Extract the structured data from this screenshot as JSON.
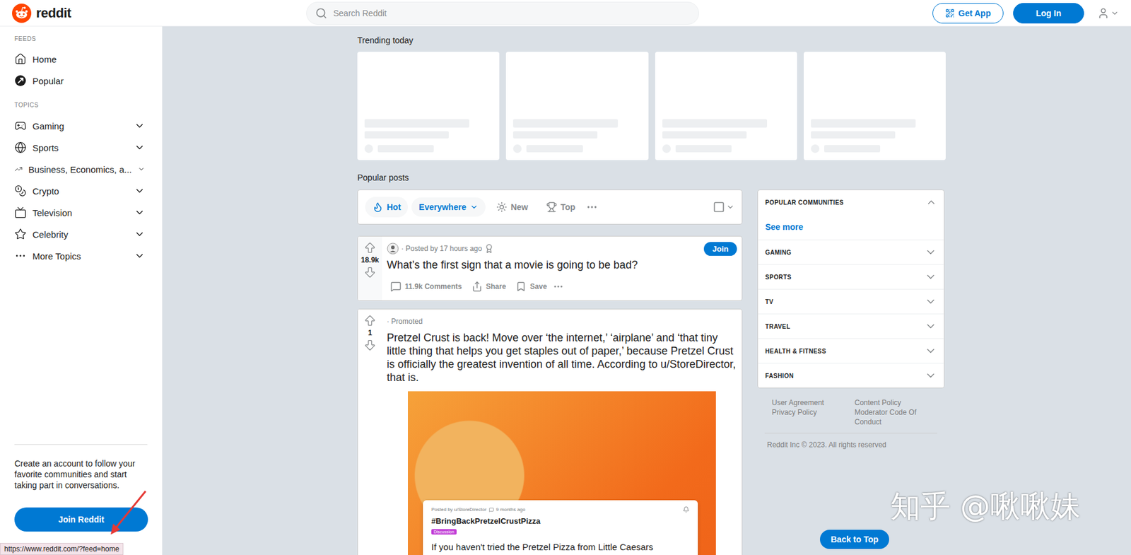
{
  "header": {
    "logo": "reddit",
    "search_placeholder": "Search Reddit",
    "get_app": "Get App",
    "log_in": "Log In"
  },
  "sidebar": {
    "sections": [
      {
        "label": "FEEDS",
        "items": [
          {
            "label": "Home",
            "kind": "feed",
            "expanded": false
          },
          {
            "label": "Popular",
            "kind": "feed",
            "expanded": false
          }
        ]
      },
      {
        "label": "TOPICS",
        "items": [
          {
            "label": "Gaming",
            "kind": "topic",
            "expanded": false
          },
          {
            "label": "Sports",
            "kind": "topic",
            "expanded": false
          },
          {
            "label": "Business, Economics, a...",
            "kind": "topic",
            "expanded": false
          },
          {
            "label": "Crypto",
            "kind": "topic",
            "expanded": false
          },
          {
            "label": "Television",
            "kind": "topic",
            "expanded": false
          },
          {
            "label": "Celebrity",
            "kind": "topic",
            "expanded": false
          },
          {
            "label": "More Topics",
            "kind": "topic",
            "expanded": false
          }
        ]
      }
    ],
    "cta": {
      "text": "Create an account to follow your favorite communities and start taking part in conversations.",
      "button": "Join Reddit"
    }
  },
  "trending": {
    "title": "Trending today",
    "cards": [
      {
        "loading": true
      },
      {
        "loading": true
      },
      {
        "loading": true
      },
      {
        "loading": true
      }
    ]
  },
  "popular": {
    "title": "Popular posts",
    "sort": [
      {
        "label": "Hot",
        "kind": "tab",
        "selected": true
      },
      {
        "label": "Everywhere",
        "kind": "dropdown",
        "selected": false
      },
      {
        "label": "New",
        "kind": "tab",
        "selected": false
      },
      {
        "label": "Top",
        "kind": "tab",
        "selected": false
      }
    ],
    "posts": [
      {
        "kind": "post",
        "votes": "18.9k",
        "meta": "· Posted by 17 hours ago",
        "join": "Join",
        "title": "What’s the first sign that a movie is going to be bad?",
        "actions": [
          "11.9k Comments",
          "Share",
          "Save"
        ]
      },
      {
        "kind": "promoted",
        "votes": "1",
        "meta": "· Promoted",
        "title": "Pretzel Crust is back! Move over ‘the internet,’ ‘airplane’ and ‘that tiny little thing that helps you get staples out of paper,’ because Pretzel Crust is officially the greatest invention of all time. According to u/StoreDirector, that is.",
        "embed": {
          "author": "Posted by u/StoreDirector",
          "time": "9 months ago",
          "title": "#BringBackPretzelCrustPizza",
          "tag": "Discussion",
          "body": "If you haven't tried the Pretzel Pizza from Little Caesars"
        }
      }
    ]
  },
  "communities": {
    "title": "POPULAR COMMUNITIES",
    "expanded": true,
    "see_more": "See more",
    "categories": [
      {
        "label": "GAMING",
        "expanded": false
      },
      {
        "label": "SPORTS",
        "expanded": false
      },
      {
        "label": "TV",
        "expanded": false
      },
      {
        "label": "TRAVEL",
        "expanded": false
      },
      {
        "label": "HEALTH & FITNESS",
        "expanded": false
      },
      {
        "label": "FASHION",
        "expanded": false
      }
    ]
  },
  "footer": {
    "links": [
      "User Agreement",
      "Privacy Policy",
      "Content Policy",
      "Moderator Code Of Conduct"
    ],
    "copyright": "Reddit Inc © 2023. All rights reserved"
  },
  "back_to_top": "Back to Top",
  "status_url": "https://www.reddit.com/?feed=home",
  "watermark": "知乎 @啾啾妹"
}
